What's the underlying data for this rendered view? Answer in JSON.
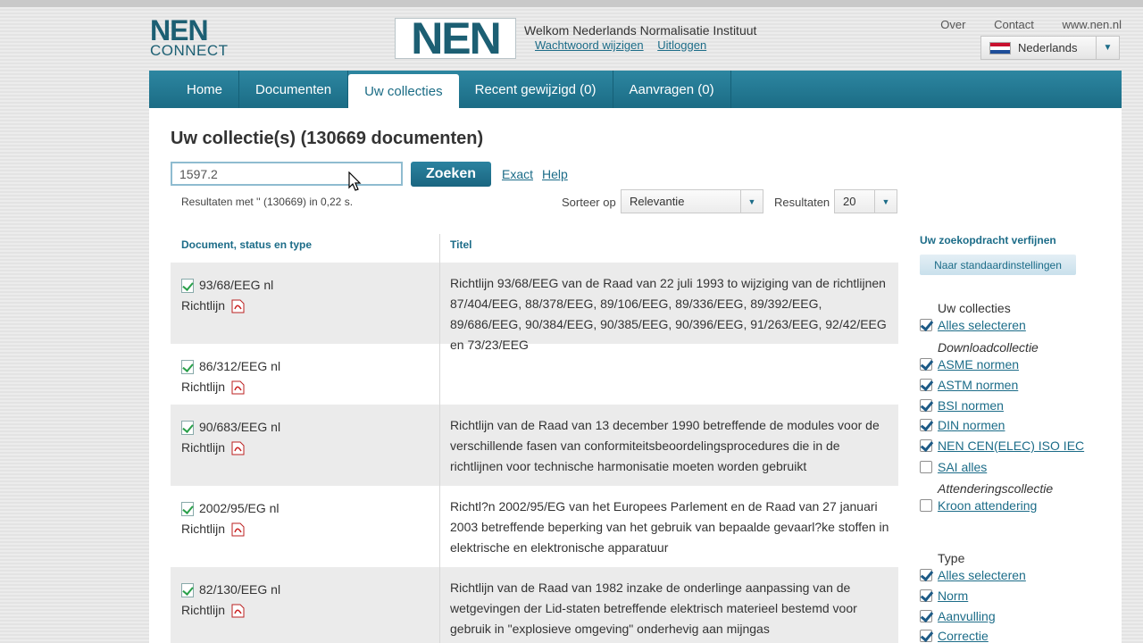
{
  "header": {
    "logo_small_line1": "NEN",
    "logo_small_line2": "CONNECT",
    "logo_big": "NEN",
    "welcome": "Welkom Nederlands Normalisatie Instituut",
    "link_password": "Wachtwoord wijzigen",
    "link_logout": "Uitloggen",
    "top_links": [
      "Over",
      "Contact",
      "www.nen.nl"
    ],
    "language": "Nederlands"
  },
  "nav": {
    "tabs": [
      "Home",
      "Documenten",
      "Uw collecties",
      "Recent gewijzigd (0)",
      "Aanvragen (0)"
    ],
    "active": "Uw collecties"
  },
  "main": {
    "title": "Uw collectie(s) (130669 documenten)",
    "search_value": "1597.2",
    "search_button": "Zoeken",
    "link_exact": "Exact",
    "link_help": "Help",
    "results_text": "Resultaten met '' (130669) in 0,22 s.",
    "sort_label": "Sorteer op",
    "sort_value": "Relevantie",
    "results_label": "Resultaten",
    "results_value": "20",
    "col_doc": "Document, status en type",
    "col_title": "Titel"
  },
  "rows": [
    {
      "id": "93/68/EEG nl",
      "type": "Richtlijn",
      "title": "Richtlijn 93/68/EEG van de Raad van 22 juli 1993 to wijziging van de richtlijnen 87/404/EEG, 88/378/EEG, 89/106/EEG, 89/336/EEG, 89/392/EEG, 89/686/EEG, 90/384/EEG, 90/385/EEG, 90/396/EEG, 91/263/EEG, 92/42/EEG en 73/23/EEG"
    },
    {
      "id": "86/312/EEG nl",
      "type": "Richtlijn",
      "title": ""
    },
    {
      "id": "90/683/EEG nl",
      "type": "Richtlijn",
      "title": "Richtlijn van de Raad van 13 december 1990 betreffende de modules voor de verschillende fasen van conformiteitsbeoordelingsprocedures die in de richtlijnen voor technische harmonisatie moeten worden gebruikt"
    },
    {
      "id": "2002/95/EG nl",
      "type": "Richtlijn",
      "title": "Richtl?n 2002/95/EG van het Europees Parlement en de Raad van 27 januari 2003 betreffende beperking van het gebruik van bepaalde gevaarl?ke stoffen in elektrische en elektronische apparatuur"
    },
    {
      "id": "82/130/EEG nl",
      "type": "Richtlijn",
      "title": "Richtlijn van de Raad van 1982 inzake de onderlinge aanpassing van de wetgevingen der Lid-staten betreffende elektrisch materieel bestemd voor gebruik in \"explosieve omgeving\" onderhevig aan mijngas"
    }
  ],
  "sidebar": {
    "heading": "Uw zoekopdracht verfijnen",
    "reset_button": "Naar standaardinstellingen",
    "group_collections": "Uw collecties",
    "select_all": "Alles selecteren",
    "group_download": "Downloadcollectie",
    "download_items": [
      "ASME normen",
      "ASTM normen",
      "BSI normen",
      "DIN normen",
      "NEN CEN(ELEC) ISO IEC",
      "SAI alles"
    ],
    "download_checked": [
      true,
      true,
      true,
      true,
      true,
      false
    ],
    "group_attend": "Attenderingscollectie",
    "attend_item": "Kroon attendering",
    "group_type": "Type",
    "type_select_all": "Alles selecteren",
    "type_items": [
      "Norm",
      "Aanvulling",
      "Correctie"
    ]
  },
  "colors": {
    "brand": "#1c6c88",
    "nav": "#1b6c85"
  }
}
